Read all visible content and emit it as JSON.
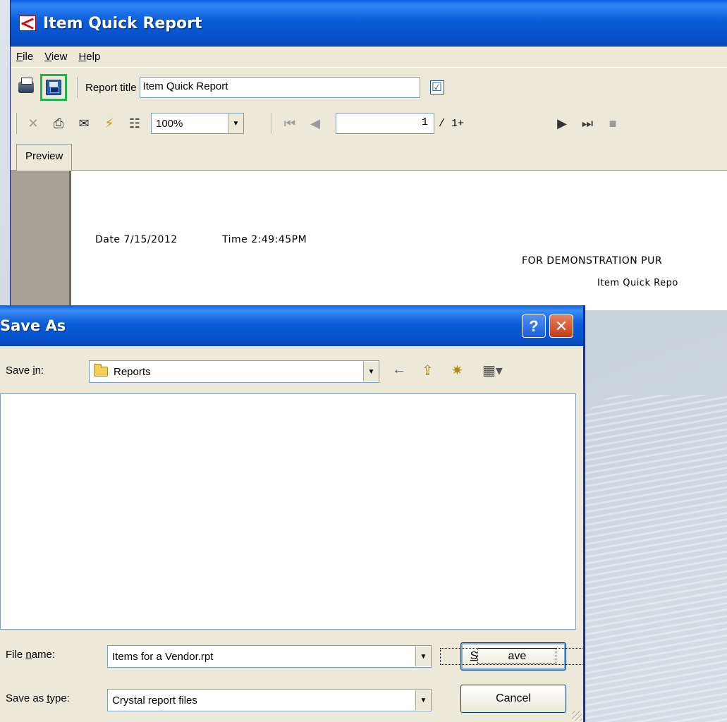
{
  "main_window": {
    "title": "Item Quick Report",
    "menu": [
      {
        "label": "File",
        "mnemonic": "F",
        "rest": "ile"
      },
      {
        "label": "View",
        "mnemonic": "V",
        "rest": "iew"
      },
      {
        "label": "Help",
        "mnemonic": "H",
        "rest": "elp"
      }
    ],
    "toolbar": {
      "report_title_label": "Report title",
      "report_title_value": "Item Quick Report",
      "checkbox_glyph": "☑"
    },
    "nav_toolbar": {
      "zoom_value": "100%",
      "page_value": "1",
      "page_total": "/ 1+"
    },
    "tabs": [
      {
        "label": "Preview"
      }
    ],
    "report": {
      "date_text": "Date 7/15/2012",
      "time_text": "Time  2:49:45PM",
      "banner_text": "FOR DEMONSTRATION PUR",
      "subtitle_text": "Item Quick Repo"
    }
  },
  "dialog": {
    "title": "Save As",
    "help_glyph": "?",
    "close_glyph": "✕",
    "save_in_label_pre": "Save ",
    "save_in_mnemonic": "i",
    "save_in_label_post": "n:",
    "save_in_value": "Reports",
    "file_name_label_pre": "File ",
    "file_name_mnemonic": "n",
    "file_name_label_post": "ame:",
    "file_name_value": "Items for a Vendor.rpt",
    "save_type_label_pre": "Save as ",
    "save_type_mnemonic": "t",
    "save_type_label_post": "ype:",
    "save_type_value": "Crystal report files",
    "save_button_mnemonic": "S",
    "save_button_rest": "ave",
    "cancel_button": "Cancel"
  },
  "colors": {
    "titlebar_blue": "#0b5cd8",
    "window_face": "#ece9d8",
    "highlight_green": "#22b14c",
    "close_red": "#c33b14"
  }
}
